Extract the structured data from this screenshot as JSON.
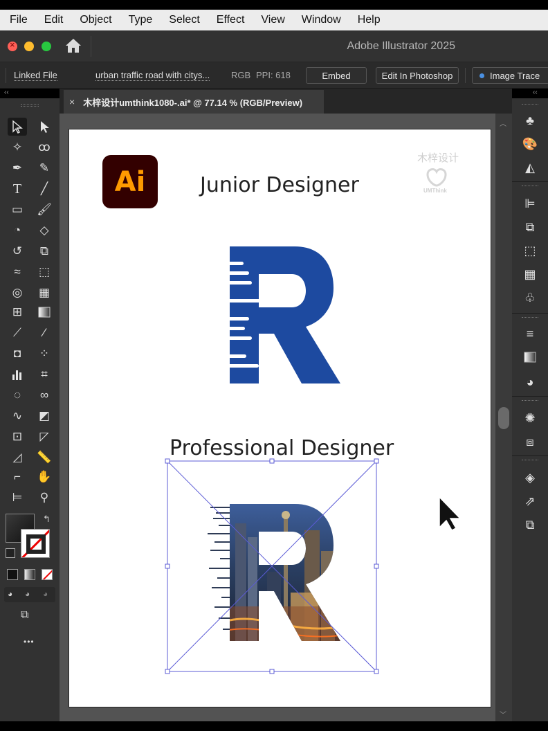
{
  "menubar": {
    "items": [
      "File",
      "Edit",
      "Object",
      "Type",
      "Select",
      "Effect",
      "View",
      "Window",
      "Help"
    ]
  },
  "titlebar": {
    "app_title": "Adobe Illustrator 2025"
  },
  "controlbar": {
    "linked_file": "Linked File",
    "file_name": "urban traffic road with citys...",
    "color_mode": "RGB",
    "ppi": "PPI: 618",
    "embed_label": "Embed",
    "edit_photoshop_label": "Edit In Photoshop",
    "image_trace_label": "Image Trace"
  },
  "document": {
    "tab_title": "木梓设计umthink1080-.ai* @ 77.14 % (RGB/Preview)",
    "close_glyph": "×"
  },
  "artboard": {
    "ai_logo_text": "Ai",
    "junior_title": "Junior Designer",
    "professional_title": "Professional Designer",
    "watermark_text": "木梓设计",
    "watermark_sub": "UMThink"
  },
  "toolbar": {
    "more_glyph": "•••"
  },
  "colors": {
    "r_blue": "#1d4aa0",
    "selection": "#5b5bd6",
    "ai_bg": "#330000",
    "ai_orange": "#ff9a00"
  }
}
